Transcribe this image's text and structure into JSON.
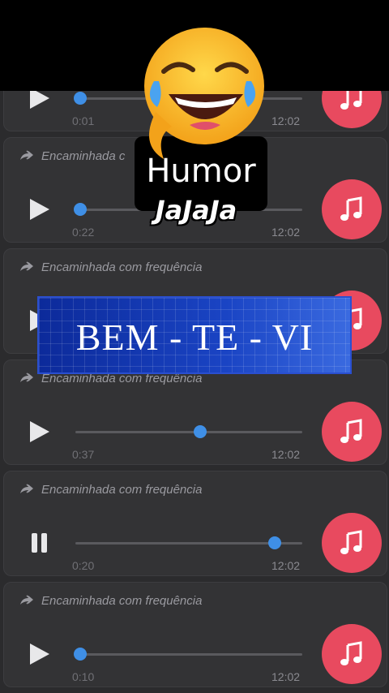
{
  "messages": [
    {
      "forward_label": "",
      "time": "0:01",
      "clock": "12:02",
      "state": "play",
      "progress": 0.02
    },
    {
      "forward_label": "Encaminhada c",
      "time": "0:22",
      "clock": "12:02",
      "state": "play",
      "progress": 0.02
    },
    {
      "forward_label": "Encaminhada com frequência",
      "time": "",
      "clock": "",
      "state": "play",
      "progress": 0.02
    },
    {
      "forward_label": "Encaminhada com frequência",
      "time": "0:37",
      "clock": "12:02",
      "state": "play",
      "progress": 0.55
    },
    {
      "forward_label": "Encaminhada com frequência",
      "time": "0:20",
      "clock": "12:02",
      "state": "pause",
      "progress": 0.88
    },
    {
      "forward_label": "Encaminhada com frequência",
      "time": "0:10",
      "clock": "12:02",
      "state": "play",
      "progress": 0.02
    }
  ],
  "overlay": {
    "humor": "Humor",
    "jaja": "JaJaJa",
    "banner": "BEM - TE - VI"
  },
  "colors": {
    "accent": "#e84a5f",
    "knob": "#3f8fe6",
    "bubble": "#333335"
  },
  "icons": [
    "forward-icon",
    "play-icon",
    "pause-icon",
    "music-note-icon",
    "laughing-emoji-icon"
  ]
}
